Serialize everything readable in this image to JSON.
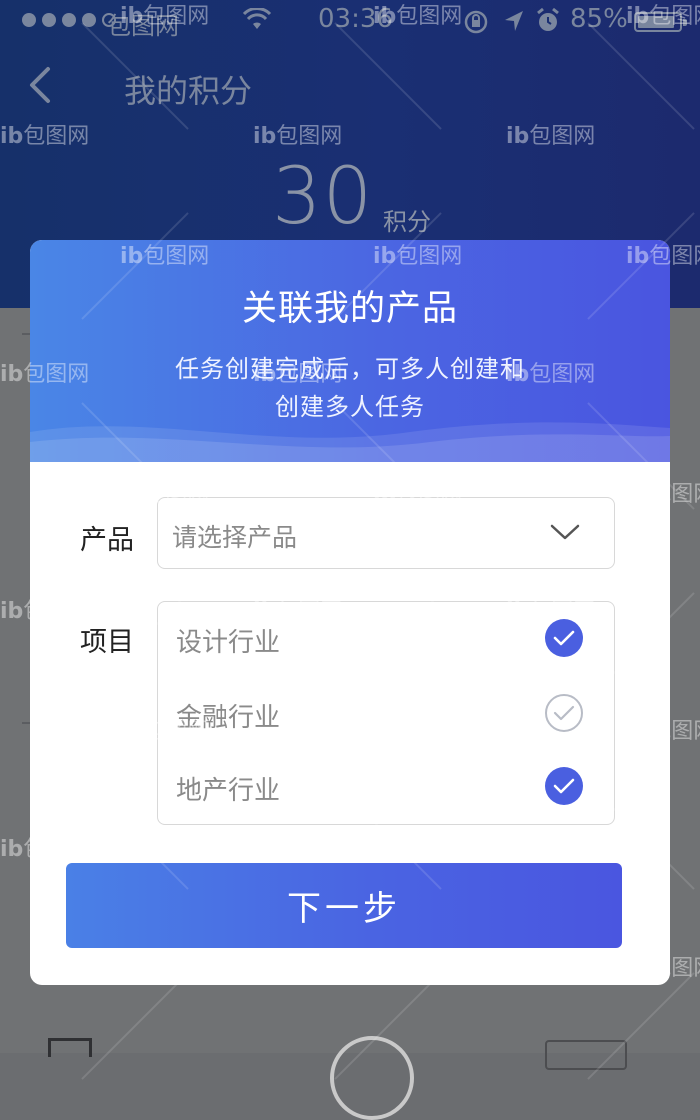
{
  "status_bar": {
    "carrier": "包图网",
    "time": "03:36",
    "battery": "85%",
    "icons": [
      "signal-dots",
      "wifi-icon",
      "rotation-lock-icon",
      "location-arrow-icon",
      "alarm-icon",
      "battery-icon"
    ]
  },
  "nav": {
    "back_icon": "chevron-left-icon",
    "title": "我的积分"
  },
  "points": {
    "value": "30",
    "unit": "积分"
  },
  "modal": {
    "title": "关联我的产品",
    "subtitle_line1": "任务创建完成后，可多人创建和",
    "subtitle_line2": "创建多人任务",
    "product": {
      "label": "产品",
      "placeholder": "请选择产品",
      "icon": "chevron-down-icon"
    },
    "project": {
      "label": "项目",
      "options": [
        {
          "label": "设计行业",
          "checked": true
        },
        {
          "label": "金融行业",
          "checked": false
        },
        {
          "label": "地产行业",
          "checked": true
        }
      ]
    },
    "next_button": "下一步"
  },
  "watermark": {
    "text": "包图网",
    "logo": "ib"
  },
  "colors": {
    "header_bg": "#1a2f73",
    "accent_blue": "#4a66e2",
    "checked_fill": "#4a5fe0",
    "unchecked_stroke": "#b8bcc6"
  }
}
